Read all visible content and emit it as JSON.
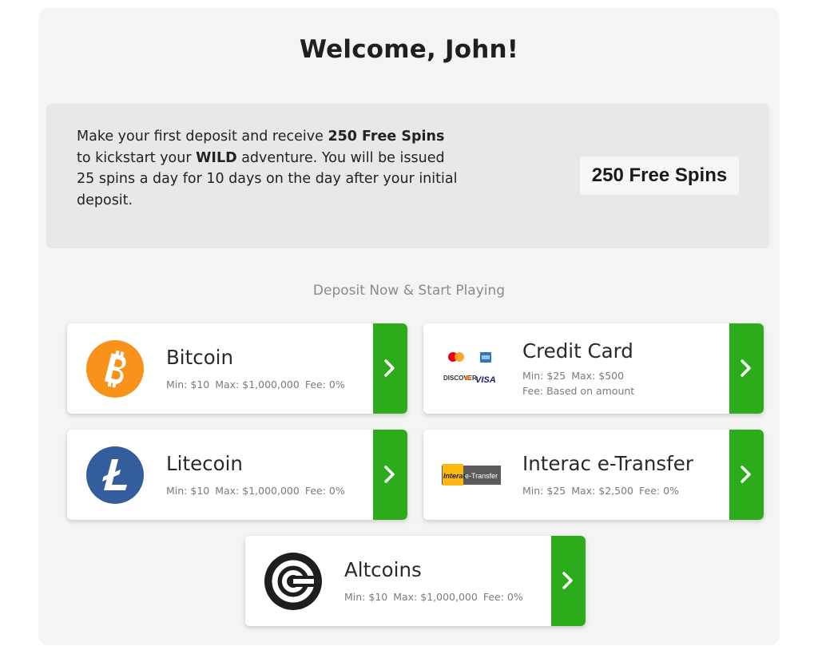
{
  "header": {
    "welcome": "Welcome, John!"
  },
  "promo": {
    "text_1": "Make your first deposit and receive ",
    "bold_1": "250 Free Spins",
    "text_2": " to kickstart your ",
    "bold_2": "WILD",
    "text_3": " adventure. You will be issued 25 spins a day for 10 days on the day after your initial deposit.",
    "badge": "250 Free Spins"
  },
  "deposit": {
    "title": "Deposit Now & Start Playing",
    "methods": [
      {
        "name": "Bitcoin",
        "min": "Min: $10",
        "max": "Max: $1,000,000",
        "fee": "Fee: 0%",
        "icon": "bitcoin-icon",
        "color": "#f7931a"
      },
      {
        "name": "Credit Card",
        "min": "Min: $25",
        "max": "Max: $500",
        "fee": "Fee: Based on amount",
        "icon": "credit-card-logos-icon",
        "logos": [
          "VISA",
          "DISCOVER"
        ]
      },
      {
        "name": "Litecoin",
        "min": "Min: $10",
        "max": "Max: $1,000,000",
        "fee": "Fee: 0%",
        "icon": "litecoin-icon",
        "color": "#345d9d"
      },
      {
        "name": "Interac e-Transfer",
        "min": "Min: $25",
        "max": "Max: $2,500",
        "fee": "Fee: 0%",
        "icon": "interac-icon",
        "logo_text": [
          "Interac",
          "e-Transfer"
        ]
      },
      {
        "name": "Altcoins",
        "min": "Min: $10",
        "max": "Max: $1,000,000",
        "fee": "Fee: 0%",
        "icon": "altcoins-icon",
        "color": "#1e1e1e"
      }
    ],
    "go_color": "#2cac1b"
  }
}
